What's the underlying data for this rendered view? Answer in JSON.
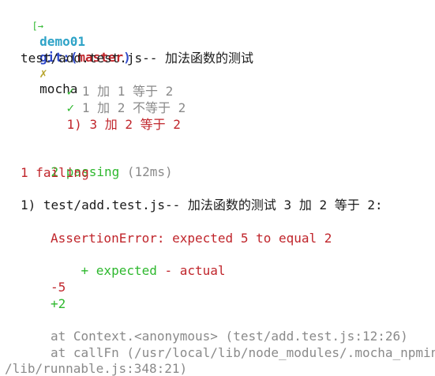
{
  "prompt": {
    "arrow": "[→",
    "dir": "demo01",
    "git_label": "git:(",
    "branch": "master",
    "git_close": ")",
    "dirty_mark": "✗",
    "command": "mocha"
  },
  "suite": {
    "title": "test/add.test.js-- 加法函数的测试",
    "tests": [
      {
        "mark": "✓",
        "name": "1 加 1 等于 2",
        "status": "pass"
      },
      {
        "mark": "✓",
        "name": "1 加 2 不等于 2",
        "status": "pass"
      },
      {
        "mark": "1)",
        "name": "3 加 2 等于 2",
        "status": "fail"
      }
    ]
  },
  "summary": {
    "passing_count": "2 passing",
    "passing_time": "(12ms)",
    "failing": "1 failing"
  },
  "failure": {
    "header": "1) test/add.test.js-- 加法函数的测试 3 加 2 等于 2:",
    "error": "AssertionError: expected 5 to equal 2",
    "legend_plus": "+ expected",
    "legend_minus": "- actual",
    "diff_minus": "-5",
    "diff_plus": "+2",
    "stack": [
      "at Context.<anonymous> (test/add.test.js:12:26)",
      "at callFn (/usr/local/lib/node_modules/.mocha_npminstall",
      "/lib/runnable.js:348:21)"
    ]
  },
  "colors": {
    "green": "#2eb82e",
    "cyan": "#2ea3c7",
    "blue": "#2f49c9",
    "red": "#c0252b",
    "gray": "#8a8a8a"
  }
}
